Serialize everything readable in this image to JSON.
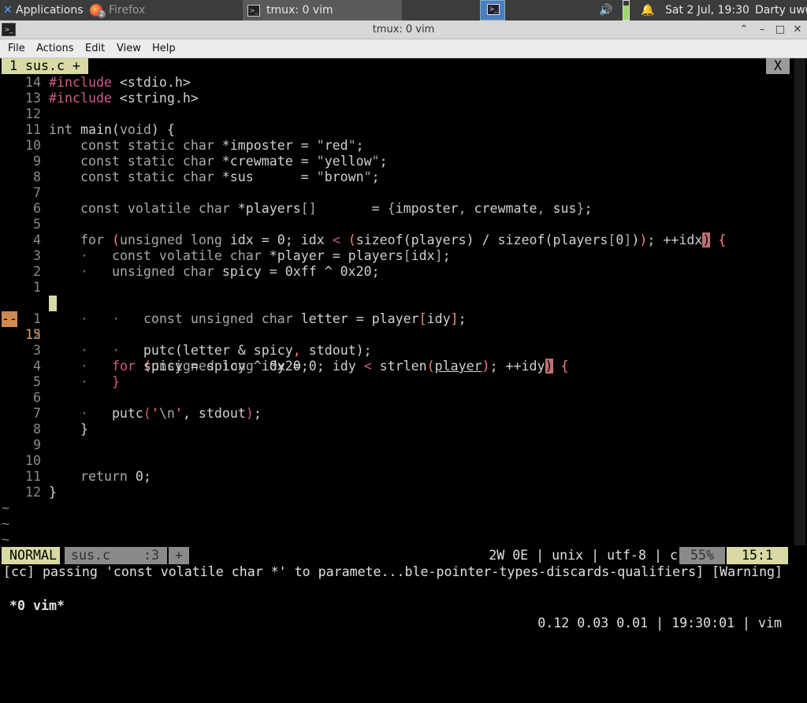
{
  "panel": {
    "applications_label": "Applications",
    "firefox_label": "Firefox",
    "firefox_badge": "2",
    "tmux_task_label": "tmux: 0 vim",
    "clock": "Sat  2 Jul, 19:30",
    "user": "Darty uwu"
  },
  "window": {
    "title": "tmux: 0 vim"
  },
  "menubar": [
    "File",
    "Actions",
    "Edit",
    "View",
    "Help"
  ],
  "vim": {
    "tab_label": "1 sus.c +",
    "tab_close": "X",
    "statusline": {
      "mode": "NORMAL",
      "file": "sus.c",
      "position": ":3",
      "modified": "+",
      "info": "2W 0E | unix | utf-8 | c",
      "percent": "55%",
      "line_col": "15:1"
    },
    "message": "[cc] passing 'const volatile char *' to paramete...ble-pointer-types-discards-qualifiers] [Warning]",
    "current_line_number": "15",
    "current_line_mark": "--",
    "tildes": [
      "~",
      "~",
      "~"
    ]
  },
  "tmux": {
    "window": "*0 vim*",
    "status_right": "0.12 0.03 0.01 | 19:30:01 | vim"
  },
  "code_lines": [
    {
      "ln": "14",
      "text": "#include <stdio.h>"
    },
    {
      "ln": "13",
      "text": "#include <string.h>"
    },
    {
      "ln": "12",
      "text": ""
    },
    {
      "ln": "11",
      "text": "int main(void) {"
    },
    {
      "ln": "10",
      "text": "    const static char *imposter = \"red\";"
    },
    {
      "ln": "9",
      "text": "    const static char *crewmate = \"yellow\";"
    },
    {
      "ln": "8",
      "text": "    const static char *sus      = \"brown\";"
    },
    {
      "ln": "7",
      "text": ""
    },
    {
      "ln": "6",
      "text": "    const volatile char *players[]       = {imposter, crewmate, sus};"
    },
    {
      "ln": "5",
      "text": ""
    },
    {
      "ln": "4",
      "text": "    for (unsigned long idx = 0; idx < (sizeof(players) / sizeof(players[0])); ++idx) {"
    },
    {
      "ln": "3",
      "text": "    ·   const volatile char *player = players[idx];"
    },
    {
      "ln": "2",
      "text": "    ·   unsigned char spicy = 0xff ^ 0x20;"
    },
    {
      "ln": "1",
      "text": ""
    },
    {
      "ln": "15",
      "text": "    ·   for (unsigned long idy = 0; idy < strlen(player); ++idy) {"
    },
    {
      "ln": "1",
      "text": "    ·   ·   const unsigned char letter = player[idy];"
    },
    {
      "ln": "2",
      "text": ""
    },
    {
      "ln": "3",
      "text": "    ·   ·   putc(letter & spicy, stdout);"
    },
    {
      "ln": "4",
      "text": "    ·   ·   spicy = spicy ^ 0x20;"
    },
    {
      "ln": "5",
      "text": "    ·   }"
    },
    {
      "ln": "6",
      "text": ""
    },
    {
      "ln": "7",
      "text": "    ·   putc('\\n', stdout);"
    },
    {
      "ln": "8",
      "text": "    }"
    },
    {
      "ln": "9",
      "text": ""
    },
    {
      "ln": "10",
      "text": ""
    },
    {
      "ln": "11",
      "text": "    return 0;"
    },
    {
      "ln": "12",
      "text": "}"
    }
  ]
}
